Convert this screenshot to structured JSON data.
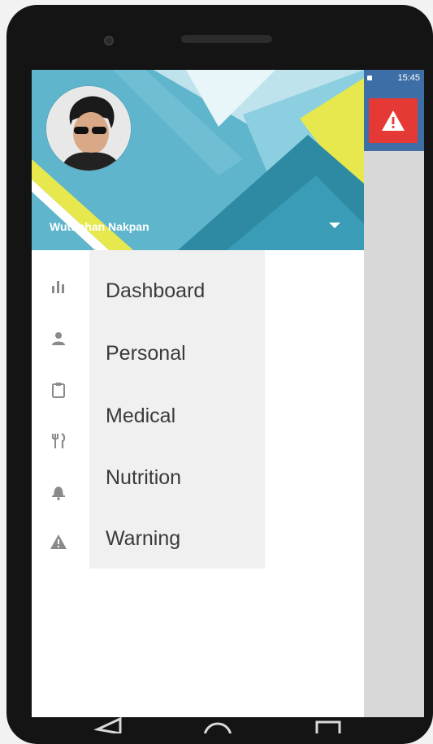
{
  "status_bar": {
    "time": "15:45"
  },
  "header": {
    "username": "Wuttiphan Nakpan",
    "colors": {
      "primary": "#5fb5cc",
      "dark": "#2e8aa3",
      "accent": "#e7e84d"
    }
  },
  "nav_icons": [
    "bar-chart-icon",
    "person-icon",
    "clipboard-icon",
    "fork-knife-icon",
    "alarm-bell-icon",
    "warning-icon"
  ],
  "menu": {
    "items": [
      {
        "label": "Dashboard"
      },
      {
        "label": "Personal"
      },
      {
        "label": "Medical"
      },
      {
        "label": "Nutrition"
      },
      {
        "label": "Warning"
      }
    ]
  },
  "app_bar": {
    "alert_color": "#e53935",
    "bar_color": "#3d6ea6"
  }
}
